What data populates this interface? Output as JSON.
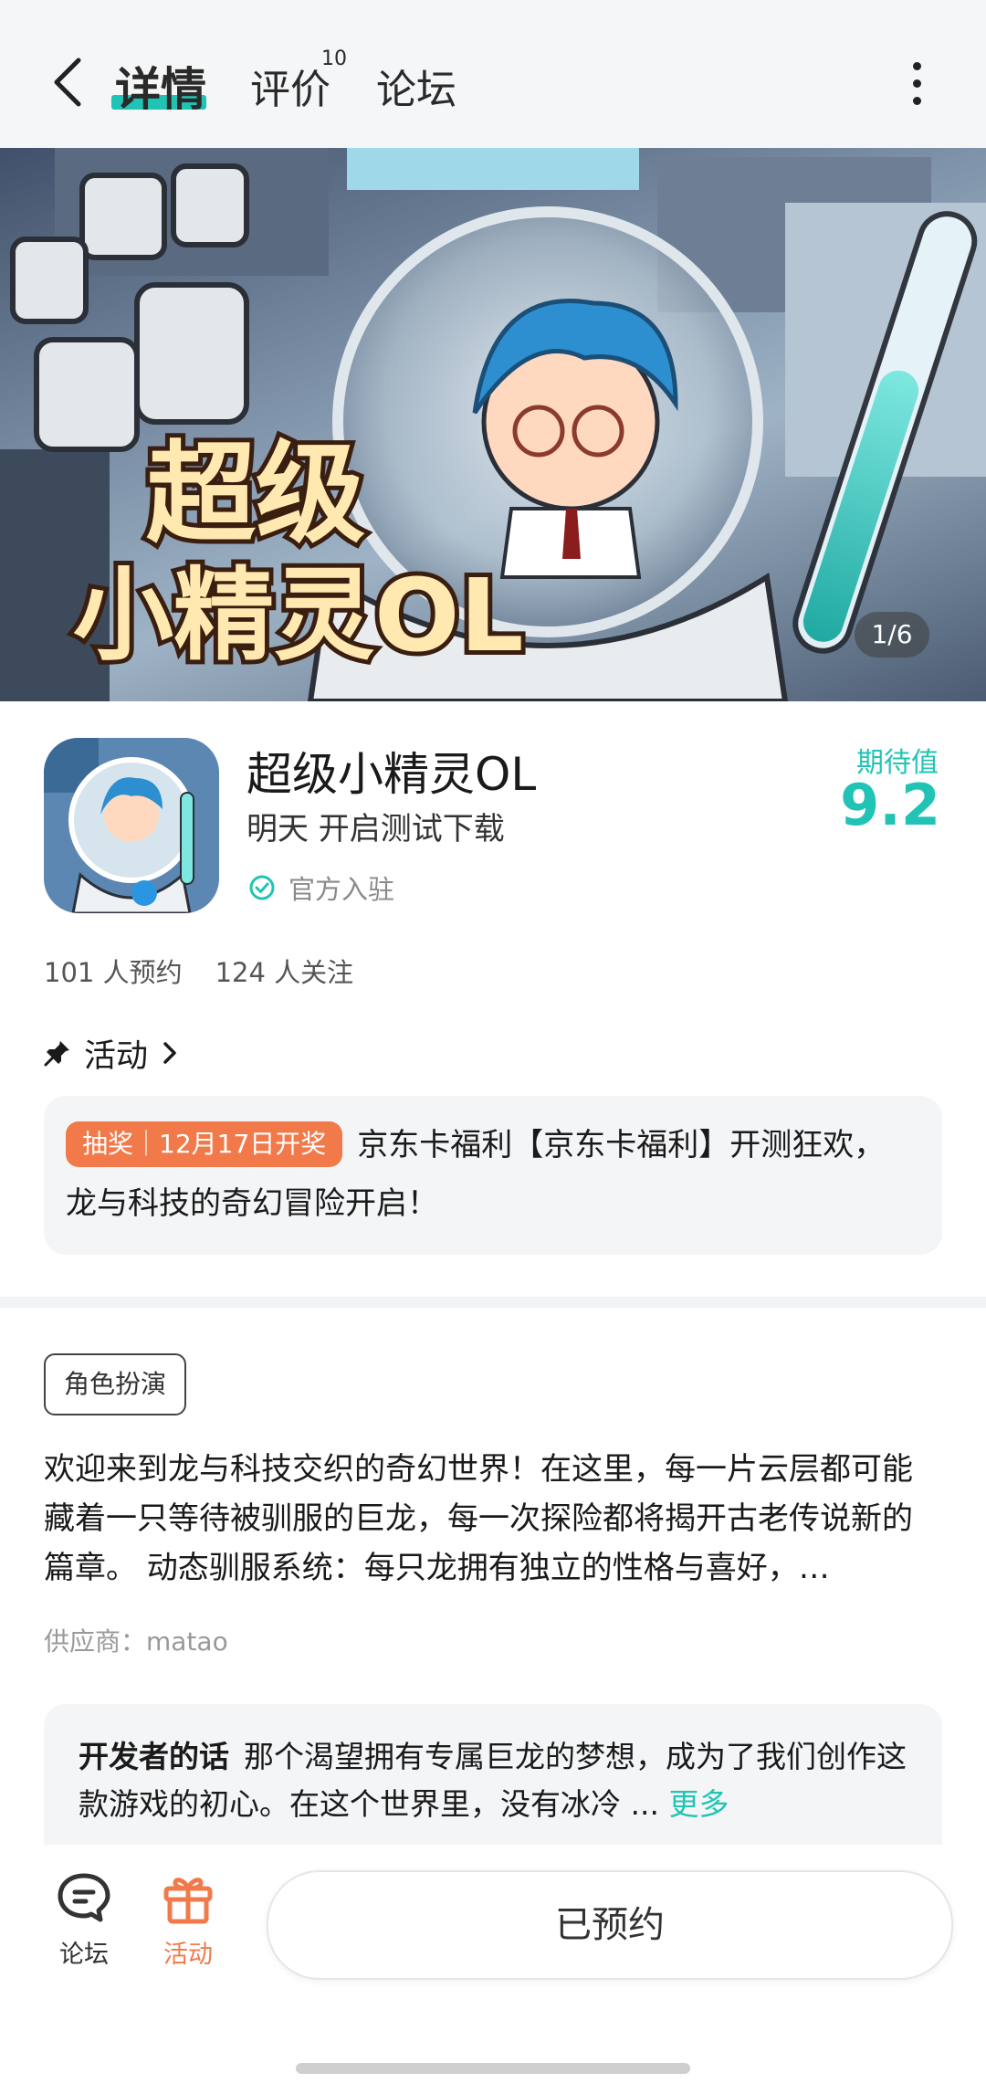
{
  "header": {
    "tabs": [
      {
        "label": "详情",
        "active": true
      },
      {
        "label": "评价",
        "badge": "10"
      },
      {
        "label": "论坛"
      }
    ]
  },
  "banner": {
    "title_art_line1": "超级",
    "title_art_line2": "小精灵OL",
    "counter": "1/6"
  },
  "app": {
    "title": "超级小精灵OL",
    "subtitle": "明天 开启测试下载",
    "verified": "官方入驻",
    "expect_label": "期待值",
    "expect_score": "9.2",
    "reservations": "101 人预约",
    "followers": "124 人关注"
  },
  "activity": {
    "heading": "活动",
    "tag": "抽奖｜12月17日开奖",
    "text": "京东卡福利【京东卡福利】开测狂欢，龙与科技的奇幻冒险开启！"
  },
  "details": {
    "genre": "角色扮演",
    "description": "欢迎来到龙与科技交织的奇幻世界！在这里，每一片云层都可能藏着一只等待被驯服的巨龙，每一次探险都将揭开古老传说新的篇章。 动态驯服系统：每只龙拥有独立的性格与喜好，…",
    "supplier": "供应商：matao"
  },
  "developer": {
    "label": "开发者的话",
    "text": "那个渴望拥有专属巨龙的梦想，成为了我们创作这款游戏的初心。在这个世界里，没有冰冷 ...",
    "more": "更多"
  },
  "bottom_nav": {
    "forum_label": "论坛",
    "activity_label": "活动",
    "reserve_button": "已预约"
  },
  "colors": {
    "accent": "#21c4b4",
    "orange": "#f27a4a"
  }
}
